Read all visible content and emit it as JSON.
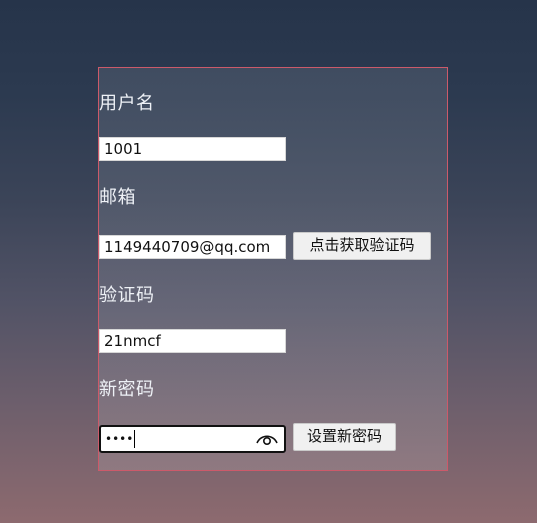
{
  "form": {
    "username": {
      "label": "用户名",
      "value": "1001"
    },
    "email": {
      "label": "邮箱",
      "value": "1149440709@qq.com",
      "send_code_button": "点击获取验证码"
    },
    "verification_code": {
      "label": "验证码",
      "value": "21nmcf"
    },
    "new_password": {
      "label": "新密码",
      "masked_value": "••••",
      "toggle_icon": "eye-icon",
      "submit_button": "设置新密码"
    }
  },
  "colors": {
    "panel_border": "#cc5a6a",
    "label_text": "#eef1f6",
    "input_bg": "#ffffff",
    "button_bg": "#f0f0f0"
  }
}
